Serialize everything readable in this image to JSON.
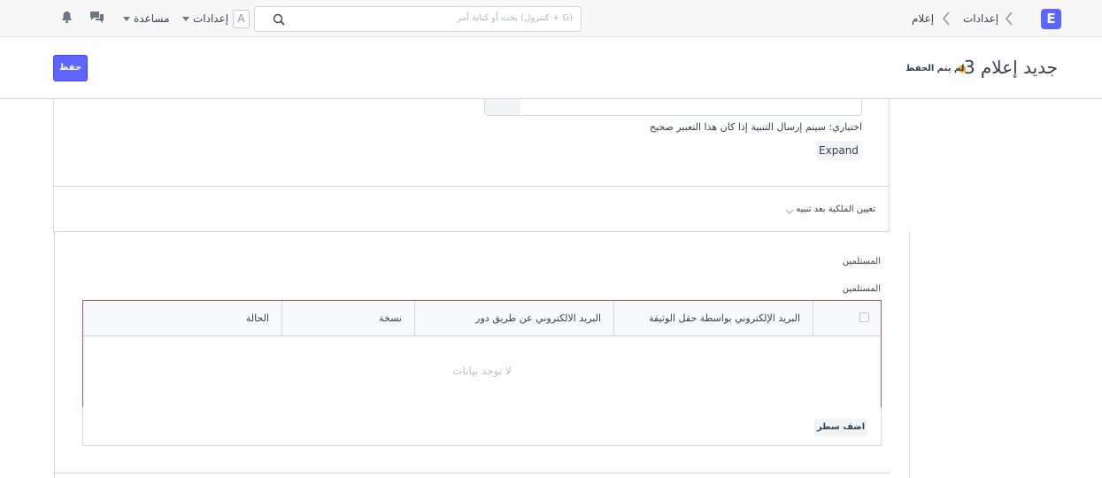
{
  "navbar": {
    "logo_letter": "E",
    "breadcrumbs": [
      "إعدادات",
      "إعلام"
    ],
    "search_placeholder": "بحث أو كتابة أمر (كنترول + G)",
    "avatar_letter": "A",
    "settings_label": "إعدادات",
    "help_label": "مساعدة",
    "icons": [
      "search-icon",
      "chat-icon",
      "bell-icon"
    ]
  },
  "page_head": {
    "title": "جديد إعلام ",
    "title_number": "3",
    "unsaved_label": "لم يتم الحفظ",
    "save_label": "حفظ"
  },
  "form": {
    "condition_help": "اختياري: سيتم إرسال التنبية إذا كان هذا التعبير صحيح",
    "expand_label": "Expand",
    "collapsible_section": "تعيين الملكية بعد تنبيه",
    "recipients_heading": "المستلمين",
    "recipients_field_label": "المستلمين"
  },
  "grid": {
    "columns": [
      "البريد الإلكتروني بواسطة حقل الوثيقة",
      "البريد الالكتروني عن طريق دور",
      "نسخة",
      "الحالة"
    ],
    "empty_text": "لا توجد بيانات",
    "add_row_label": "اضف سطر"
  },
  "colors": {
    "primary": "#5e64ff",
    "indicator_orange": "#ffa00a",
    "error_border": "#e24c4c"
  }
}
